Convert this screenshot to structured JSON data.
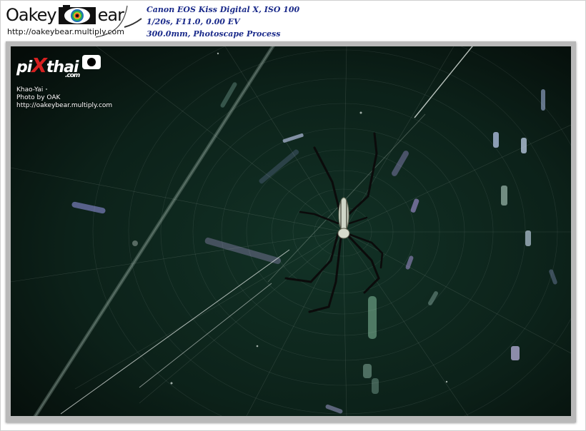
{
  "header": {
    "logo_left": "Oakey",
    "logo_right": "ear",
    "logo_url": "http://oakeybear.multiply.com",
    "exif": [
      "Canon EOS Kiss Digital X, ISO 100",
      "1/20s, F11.0, 0.00 EV",
      "300.0mm, Photoscape Process"
    ]
  },
  "photo": {
    "subject": "spider-on-web",
    "watermark": {
      "logo_pi": "pi",
      "logo_x": "X",
      "logo_thai": "thai",
      "logo_com": ".com",
      "lines": [
        "Khao-Yai",
        "Photo by OAK",
        "http://oakeybear.multiply.com"
      ]
    }
  },
  "colors": {
    "background": "#0b1a14",
    "exif_text": "#1a2a8a",
    "frame": "#b9b9b9",
    "logo_x": "#d62020"
  }
}
